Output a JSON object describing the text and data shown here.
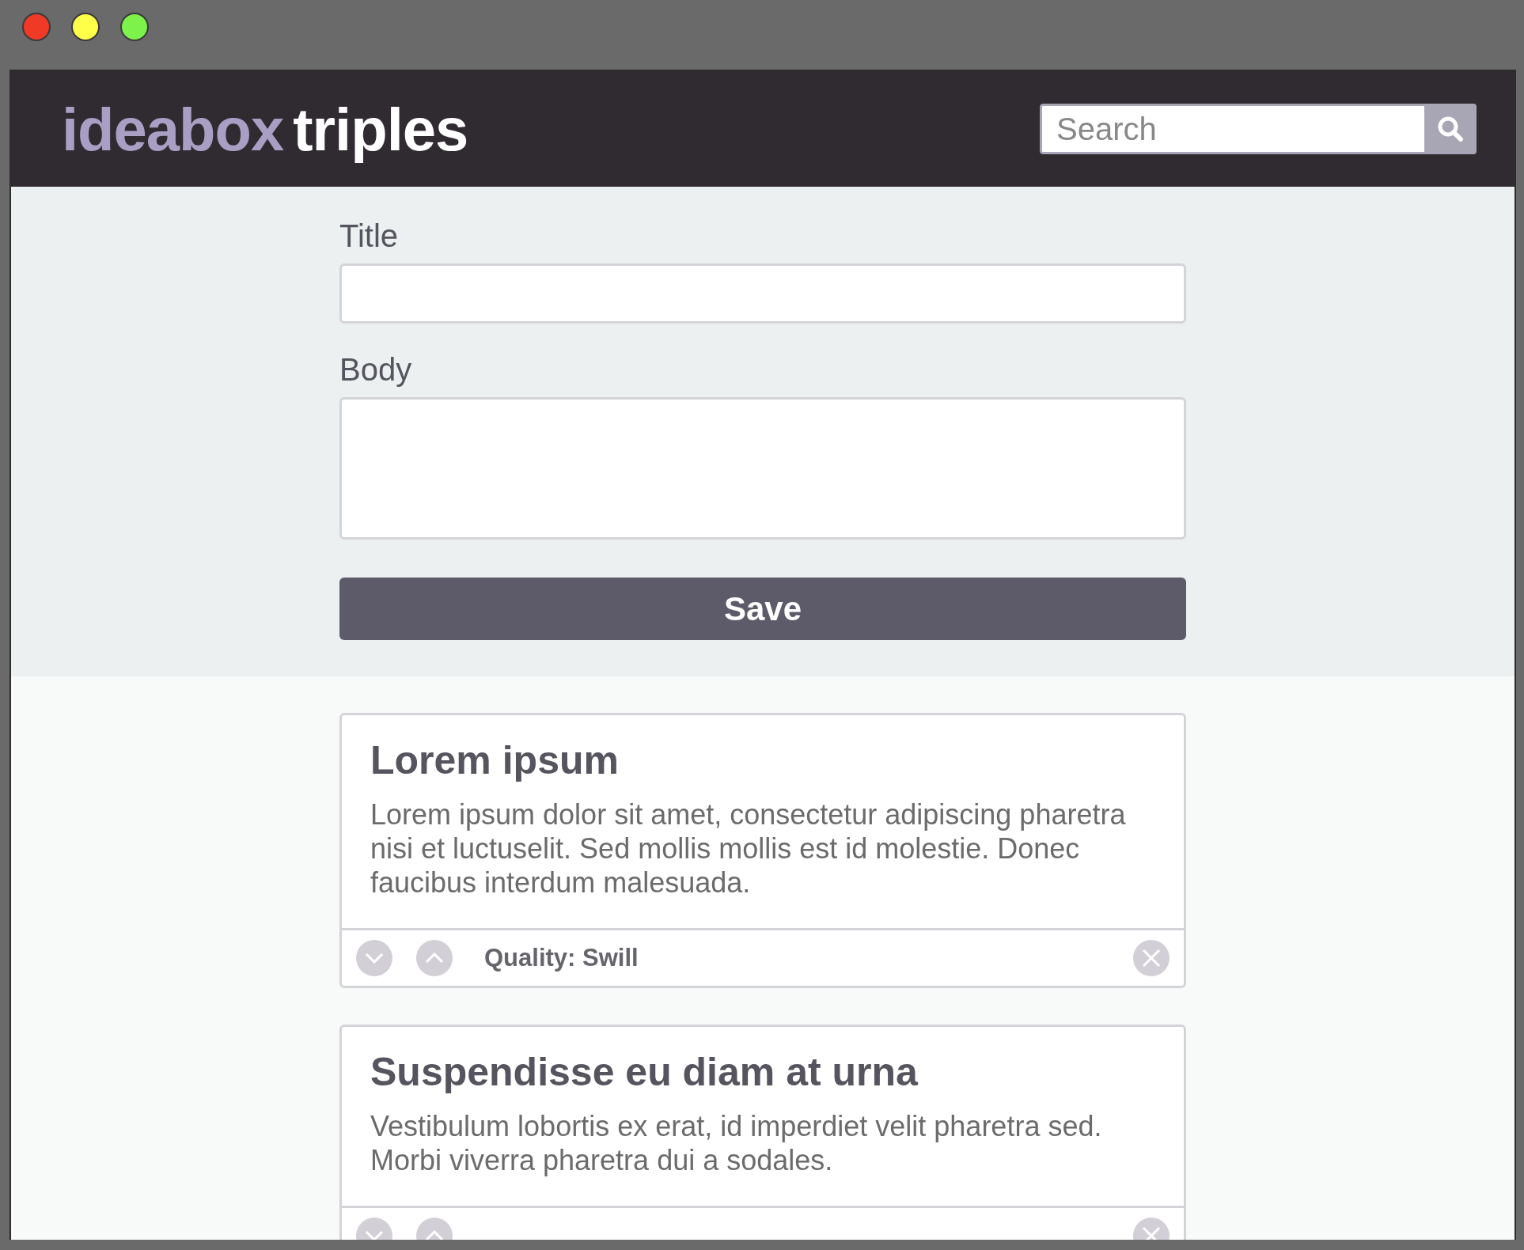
{
  "window": {
    "controls": [
      {
        "color": "#f03a25"
      },
      {
        "color": "#ffff4a"
      },
      {
        "color": "#7cf24a"
      }
    ]
  },
  "header": {
    "logo_primary": "ideabox",
    "logo_secondary": "triples",
    "search": {
      "placeholder": "Search"
    }
  },
  "form": {
    "title_label": "Title",
    "body_label": "Body",
    "save_button": "Save"
  },
  "ideas": [
    {
      "title": "Lorem ipsum",
      "body": "Lorem ipsum dolor sit amet, consectetur adipiscing pharetra nisi et luctuselit. Sed mollis mollis est id molestie. Donec faucibus interdum malesuada.",
      "quality": "Quality: Swill"
    },
    {
      "title": "Suspendisse eu diam at urna",
      "body": "Vestibulum lobortis ex erat, id imperdiet velit pharetra sed. Morbi viverra pharetra dui a sodales."
    }
  ]
}
